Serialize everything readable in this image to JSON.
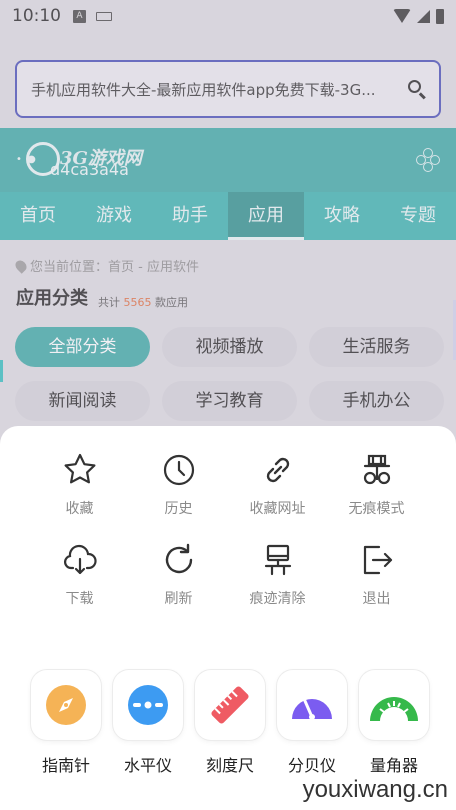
{
  "status": {
    "time": "10:10"
  },
  "browser": {
    "url_text": "手机应用软件大全-最新应用软件app免费下载-3G..."
  },
  "site": {
    "logo_text": "3G游戏网",
    "logo_overlay": "d4ca3a4a",
    "nav": [
      {
        "label": "首页"
      },
      {
        "label": "游戏"
      },
      {
        "label": "助手"
      },
      {
        "label": "应用",
        "active": true
      },
      {
        "label": "攻略"
      },
      {
        "label": "专题"
      }
    ],
    "breadcrumb": "您当前位置：首页 - 应用软件",
    "category_title": "应用分类",
    "count_prefix": "共计",
    "count_value": "5565",
    "count_suffix": "款应用",
    "chips": [
      "全部分类",
      "视频播放",
      "生活服务",
      "新闻阅读",
      "学习教育",
      "手机办公"
    ]
  },
  "menu": {
    "items": [
      {
        "label": "收藏",
        "icon": "star-icon"
      },
      {
        "label": "历史",
        "icon": "clock-icon"
      },
      {
        "label": "收藏网址",
        "icon": "link-icon"
      },
      {
        "label": "无痕模式",
        "icon": "incognito-icon"
      },
      {
        "label": "下载",
        "icon": "cloud-download-icon"
      },
      {
        "label": "刷新",
        "icon": "refresh-icon"
      },
      {
        "label": "痕迹清除",
        "icon": "clear-trace-icon"
      },
      {
        "label": "退出",
        "icon": "exit-icon"
      }
    ]
  },
  "tools": [
    {
      "label": "指南针",
      "icon": "compass-icon",
      "color": "#f3a642"
    },
    {
      "label": "水平仪",
      "icon": "level-icon",
      "color": "#3d9bf2"
    },
    {
      "label": "刻度尺",
      "icon": "ruler-icon",
      "color": "#ef5b63"
    },
    {
      "label": "分贝仪",
      "icon": "decibel-icon",
      "color": "#7b5cf0"
    },
    {
      "label": "量角器",
      "icon": "protractor-icon",
      "color": "#36b94b"
    }
  ],
  "watermark": "youxiwang.cn"
}
